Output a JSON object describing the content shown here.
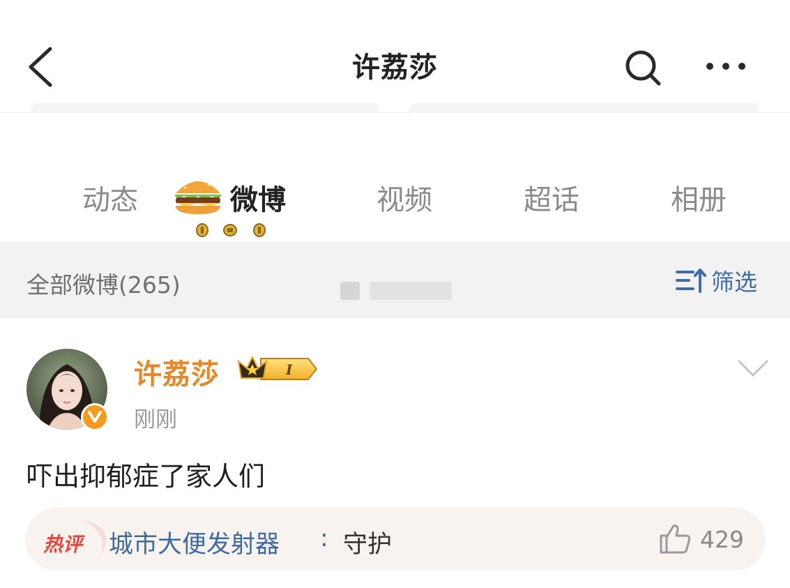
{
  "header": {
    "title": "许荔莎",
    "icons": [
      "back-icon",
      "search-icon",
      "more-icon"
    ]
  },
  "tabs": [
    {
      "label": "动态",
      "active": false
    },
    {
      "label": "微博",
      "active": true,
      "icon": "burger-icon"
    },
    {
      "label": "视频",
      "active": false
    },
    {
      "label": "超话",
      "active": false
    },
    {
      "label": "相册",
      "active": false
    }
  ],
  "filter": {
    "count_label": "全部微博(265)",
    "button_label": "筛选",
    "icon": "filter-sort-icon"
  },
  "post": {
    "author": "许荔莎",
    "badge_level": "I",
    "verified": true,
    "time": "刚刚",
    "text": "吓出抑郁症了家人们",
    "hot_comment": {
      "tag": "热评",
      "user": "城市大便发射器",
      "colon": ":",
      "text": "守护",
      "likes": "429"
    }
  },
  "colors": {
    "author_name": "#e6872a",
    "link_blue": "#3e6aa0",
    "hot_tag_red": "#e8463c",
    "verify_orange": "#f39b1f"
  }
}
